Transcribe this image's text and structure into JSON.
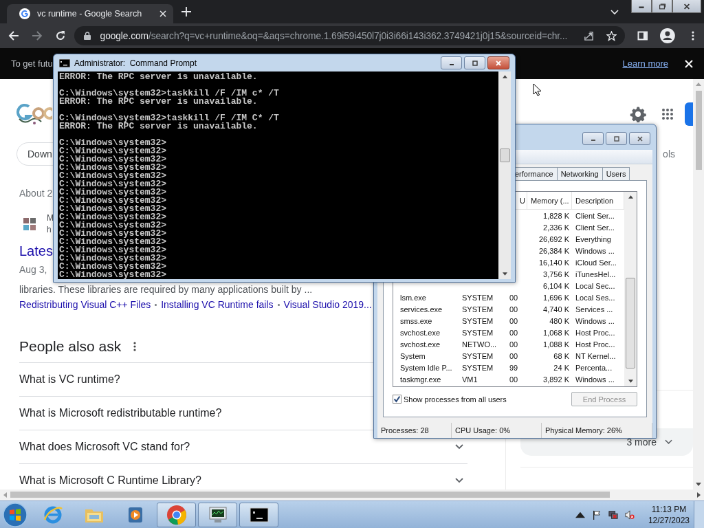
{
  "browser": {
    "tab": {
      "title": "vc runtime - Google Search"
    },
    "url": {
      "host": "google.com",
      "path": "/search?q=vc+runtime&oq=&aqs=chrome.1.69i59i450l7j0i3i66i143i362.3749421j0j15&sourceid=chr..."
    }
  },
  "banner": {
    "text": "To get futu",
    "link": "Learn more"
  },
  "search_page": {
    "chip": "Down",
    "tools": "ols",
    "stats": "About 2",
    "result": {
      "site_initial": "M",
      "url_initial": "h",
      "title": "Lates",
      "date": "Aug 3,",
      "snippet": "libraries. These libraries are required by many applications built by ...",
      "links": [
        "Redistributing Visual C++ Files",
        "Installing VC Runtime fails",
        "Visual Studio 2019..."
      ]
    },
    "people_also_ask": {
      "title": "People also ask",
      "questions": [
        "What is VC runtime?",
        "What is Microsoft redistributable runtime?",
        "What does Microsoft VC stand for?",
        "What is Microsoft C Runtime Library?"
      ]
    },
    "side_panel": {
      "more": "3 more"
    }
  },
  "command_prompt": {
    "title": "Administrator:  Command Prompt",
    "blocks": [
      [
        "ERROR: The RPC server is unavailable."
      ],
      [
        "C:\\Windows\\system32>taskkill /F /IM c* /T",
        "ERROR: The RPC server is unavailable."
      ],
      [
        "C:\\Windows\\system32>taskkill /F /IM C* /T",
        "ERROR: The RPC server is unavailable."
      ],
      [
        "C:\\Windows\\system32>",
        "C:\\Windows\\system32>",
        "C:\\Windows\\system32>",
        "C:\\Windows\\system32>",
        "C:\\Windows\\system32>",
        "C:\\Windows\\system32>",
        "C:\\Windows\\system32>",
        "C:\\Windows\\system32>",
        "C:\\Windows\\system32>",
        "C:\\Windows\\system32>",
        "C:\\Windows\\system32>",
        "C:\\Windows\\system32>",
        "C:\\Windows\\system32>",
        "C:\\Windows\\system32>",
        "C:\\Windows\\system32>",
        "C:\\Windows\\system32>",
        "C:\\Windows\\system32>"
      ]
    ]
  },
  "task_manager": {
    "tabs": [
      {
        "label": "erformance",
        "selected": false
      },
      {
        "label": "Networking",
        "selected": false
      },
      {
        "label": "Users",
        "selected": false
      }
    ],
    "columns": {
      "cpu": "U",
      "memory": "Memory (...",
      "description": "Description"
    },
    "rows": [
      {
        "memory": "1,828 K",
        "description": "Client Ser..."
      },
      {
        "memory": "2,336 K",
        "description": "Client Ser..."
      },
      {
        "memory": "26,692 K",
        "description": "Everything"
      },
      {
        "memory": "26,384 K",
        "description": "Windows ..."
      },
      {
        "memory": "16,140 K",
        "description": "iCloud Ser..."
      },
      {
        "memory": "3,756 K",
        "description": "iTunesHel..."
      },
      {
        "memory": "6,104 K",
        "description": "Local Sec..."
      },
      {
        "name": "lsm.exe",
        "user": "SYSTEM",
        "cpu": "00",
        "memory": "1,696 K",
        "description": "Local Ses..."
      },
      {
        "name": "services.exe",
        "user": "SYSTEM",
        "cpu": "00",
        "memory": "4,740 K",
        "description": "Services ..."
      },
      {
        "name": "smss.exe",
        "user": "SYSTEM",
        "cpu": "00",
        "memory": "480 K",
        "description": "Windows ..."
      },
      {
        "name": "svchost.exe",
        "user": "SYSTEM",
        "cpu": "00",
        "memory": "1,068 K",
        "description": "Host Proc..."
      },
      {
        "name": "svchost.exe",
        "user": "NETWO...",
        "cpu": "00",
        "memory": "1,088 K",
        "description": "Host Proc..."
      },
      {
        "name": "System",
        "user": "SYSTEM",
        "cpu": "00",
        "memory": "68 K",
        "description": "NT Kernel..."
      },
      {
        "name": "System Idle P...",
        "user": "SYSTEM",
        "cpu": "99",
        "memory": "24 K",
        "description": "Percenta..."
      },
      {
        "name": "taskmgr.exe",
        "user": "VM1",
        "cpu": "00",
        "memory": "3,892 K",
        "description": "Windows ..."
      }
    ],
    "show_all": {
      "label": "Show processes from all users",
      "checked": true
    },
    "end_button": {
      "label": "End Process",
      "disabled": true
    },
    "status": [
      "Processes: 28",
      "CPU Usage: 0%",
      "Physical Memory: 26%"
    ]
  },
  "taskbar": {
    "apps": [
      {
        "kind": "ie",
        "running": false
      },
      {
        "kind": "folder",
        "running": false
      },
      {
        "kind": "media",
        "running": false
      },
      {
        "kind": "chrome",
        "running": true
      },
      {
        "kind": "taskmgr",
        "running": true
      },
      {
        "kind": "cmd",
        "running": true
      }
    ],
    "clock": {
      "time": "11:13 PM",
      "date": "12/27/2023"
    }
  }
}
